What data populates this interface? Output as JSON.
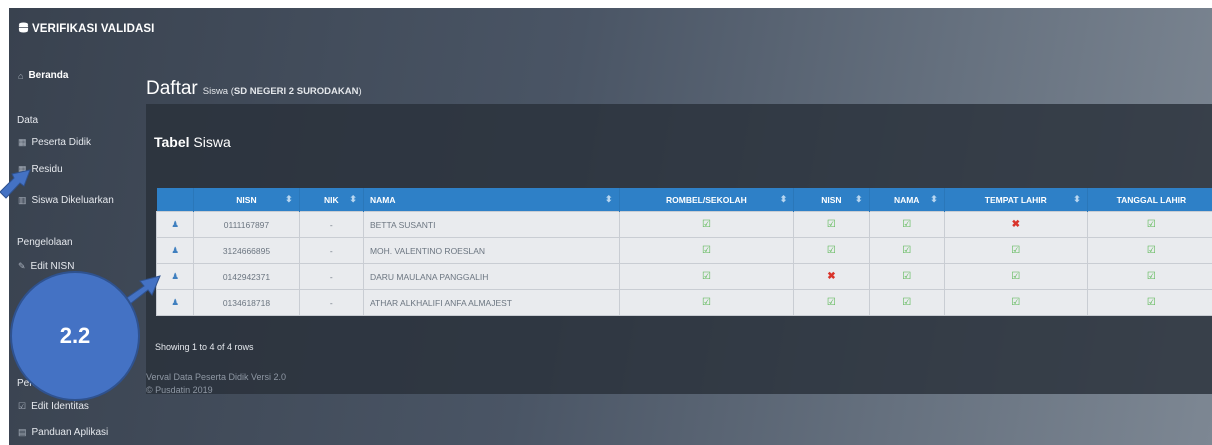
{
  "brand": "VERIFIKASI VALIDASI",
  "sidebar": {
    "home": "Beranda",
    "section_data": "Data",
    "items": [
      "Peserta Didik",
      "Residu",
      "Siswa Dikeluarkan"
    ],
    "section_manage": "Pengelolaan",
    "manage_items": [
      "Edit NISN"
    ],
    "section_submit": "Pengajuan",
    "submit_items": [
      "Edit Identitas",
      "Panduan Aplikasi"
    ]
  },
  "page": {
    "title": "Daftar",
    "subtitle_prefix": "Siswa (",
    "school": "SD NEGERI 2 SURODAKAN",
    "subtitle_suffix": ")"
  },
  "panel": {
    "title_bold": "Tabel",
    "title_rest": "Siswa"
  },
  "table": {
    "headers": [
      "NISN",
      "NIK",
      "NAMA",
      "ROMBEL/SEKOLAH",
      "NISN",
      "NAMA",
      "TEMPAT LAHIR",
      "TANGGAL LAHIR"
    ],
    "rows": [
      {
        "nisn": "0111167897",
        "nik": "-",
        "nama": "BETTA SUSANTI",
        "checks": [
          "ok",
          "ok",
          "ok",
          "bad",
          "ok"
        ]
      },
      {
        "nisn": "3124666895",
        "nik": "-",
        "nama": "MOH. VALENTINO ROESLAN",
        "checks": [
          "ok",
          "ok",
          "ok",
          "ok",
          "ok"
        ]
      },
      {
        "nisn": "0142942371",
        "nik": "-",
        "nama": "DARU MAULANA PANGGALIH",
        "checks": [
          "ok",
          "bad",
          "ok",
          "ok",
          "ok"
        ]
      },
      {
        "nisn": "0134618718",
        "nik": "-",
        "nama": "ATHAR ALKHALIFI ANFA ALMAJEST",
        "checks": [
          "ok",
          "ok",
          "ok",
          "ok",
          "ok"
        ]
      }
    ],
    "showing": "Showing 1 to 4 of 4 rows"
  },
  "footer": {
    "line1": "Verval Data Peserta Didik Versi 2.0",
    "line2": "© Pusdatin 2019"
  },
  "callout": "2.2",
  "colors": {
    "header_blue": "#2e80c7",
    "callout_blue": "#4472c4",
    "ok_green": "#55b64f",
    "bad_red": "#d9342b"
  }
}
